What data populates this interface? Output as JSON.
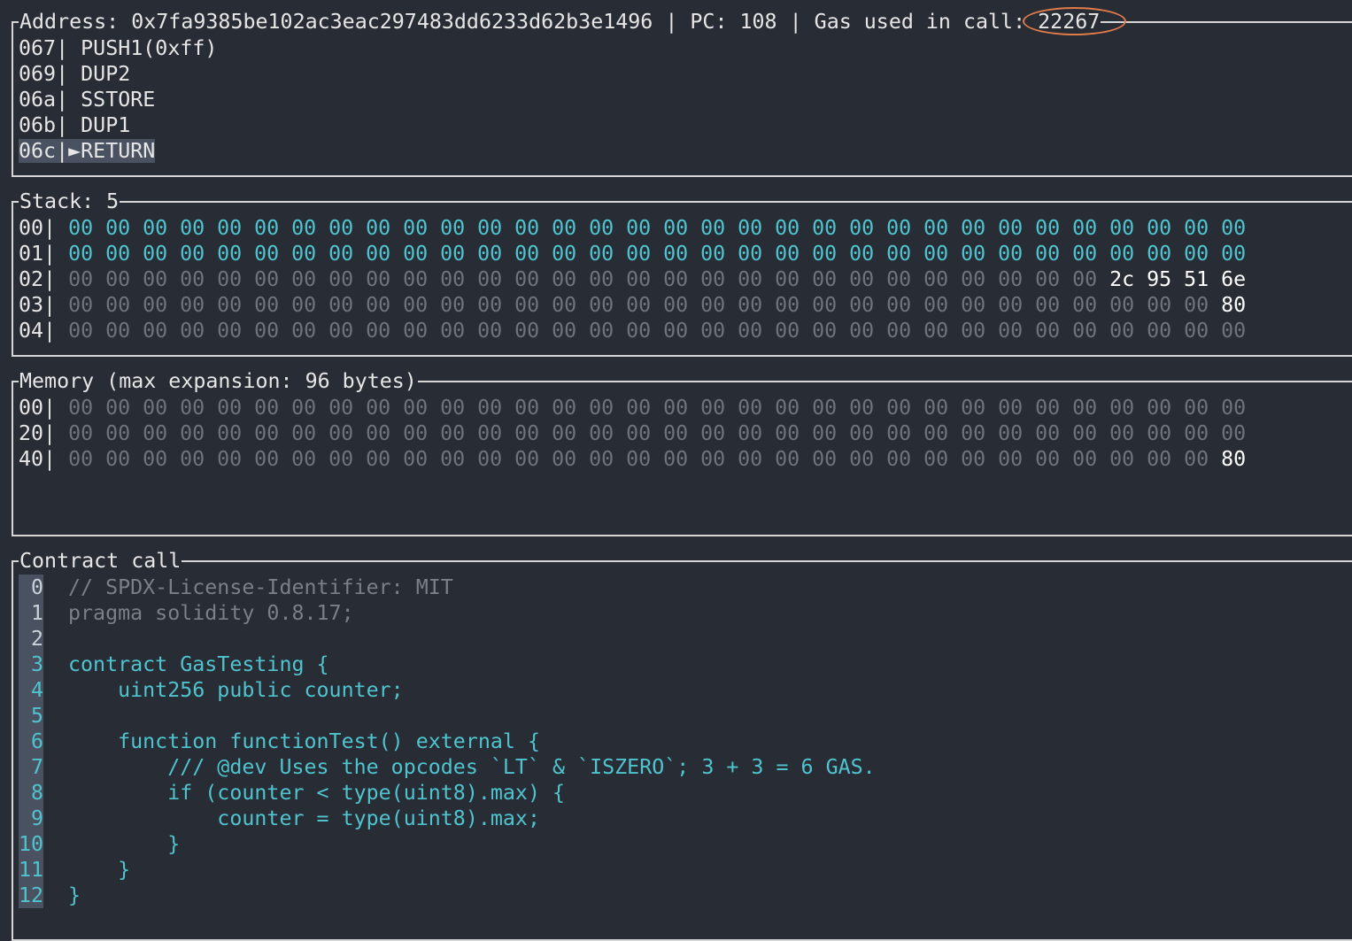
{
  "header": {
    "address_label": "Address: ",
    "address": "0x7fa9385be102ac3eac297483dd6233d62b3e1496",
    "pc_text": " | PC: 108 | Gas used in call: ",
    "gas_used": "22267"
  },
  "opcodes": [
    {
      "addr": "067",
      "sep": "| ",
      "op": "PUSH1(0xff)",
      "current": false
    },
    {
      "addr": "069",
      "sep": "| ",
      "op": "DUP2",
      "current": false
    },
    {
      "addr": "06a",
      "sep": "| ",
      "op": "SSTORE",
      "current": false
    },
    {
      "addr": "06b",
      "sep": "| ",
      "op": "DUP1",
      "current": false
    },
    {
      "addr": "06c",
      "sep": "|►",
      "op": "RETURN",
      "current": true
    }
  ],
  "stack": {
    "title": "Stack: 5",
    "rows": [
      {
        "idx": "00|",
        "bytes": "00 00 00 00 00 00 00 00 00 00 00 00 00 00 00 00 00 00 00 00 00 00 00 00 00 00 00 00 00 00 00 00",
        "tone": "teal"
      },
      {
        "idx": "01|",
        "bytes": "00 00 00 00 00 00 00 00 00 00 00 00 00 00 00 00 00 00 00 00 00 00 00 00 00 00 00 00 00 00 00 00",
        "tone": "teal"
      },
      {
        "idx": "02|",
        "bytes": "00 00 00 00 00 00 00 00 00 00 00 00 00 00 00 00 00 00 00 00 00 00 00 00 00 00 00 00 2c 95 51 6e",
        "tone": "dim"
      },
      {
        "idx": "03|",
        "bytes": "00 00 00 00 00 00 00 00 00 00 00 00 00 00 00 00 00 00 00 00 00 00 00 00 00 00 00 00 00 00 00 80",
        "tone": "dim"
      },
      {
        "idx": "04|",
        "bytes": "00 00 00 00 00 00 00 00 00 00 00 00 00 00 00 00 00 00 00 00 00 00 00 00 00 00 00 00 00 00 00 00",
        "tone": "dim"
      }
    ]
  },
  "memory": {
    "title": "Memory (max expansion: 96 bytes)",
    "rows": [
      {
        "idx": "00|",
        "bytes": "00 00 00 00 00 00 00 00 00 00 00 00 00 00 00 00 00 00 00 00 00 00 00 00 00 00 00 00 00 00 00 00"
      },
      {
        "idx": "20|",
        "bytes": "00 00 00 00 00 00 00 00 00 00 00 00 00 00 00 00 00 00 00 00 00 00 00 00 00 00 00 00 00 00 00 00"
      },
      {
        "idx": "40|",
        "bytes": "00 00 00 00 00 00 00 00 00 00 00 00 00 00 00 00 00 00 00 00 00 00 00 00 00 00 00 00 00 00 00 80"
      }
    ]
  },
  "contract": {
    "title": "Contract call",
    "lines": [
      {
        "n": "0",
        "text": "// SPDX-License-Identifier: MIT",
        "tone": "comment"
      },
      {
        "n": "1",
        "text": "pragma solidity 0.8.17;",
        "tone": "comment"
      },
      {
        "n": "2",
        "text": "",
        "tone": "comment"
      },
      {
        "n": "3",
        "text": "contract GasTesting {",
        "tone": "teal"
      },
      {
        "n": "4",
        "text": "    uint256 public counter;",
        "tone": "teal"
      },
      {
        "n": "5",
        "text": "",
        "tone": "teal"
      },
      {
        "n": "6",
        "text": "    function functionTest() external {",
        "tone": "teal"
      },
      {
        "n": "7",
        "text": "        /// @dev Uses the opcodes `LT` & `ISZERO`; 3 + 3 = 6 GAS.",
        "tone": "teal"
      },
      {
        "n": "8",
        "text": "        if (counter < type(uint8).max) {",
        "tone": "teal"
      },
      {
        "n": "9",
        "text": "            counter = type(uint8).max;",
        "tone": "teal"
      },
      {
        "n": "10",
        "text": "        }",
        "tone": "teal"
      },
      {
        "n": "11",
        "text": "    }",
        "tone": "teal"
      },
      {
        "n": "12",
        "text": "}",
        "tone": "teal"
      }
    ]
  },
  "colors": {
    "background": "#282c34",
    "teal": "#4fc4cf",
    "dim": "#6e737c",
    "highlight_circle": "#e07b4a"
  }
}
